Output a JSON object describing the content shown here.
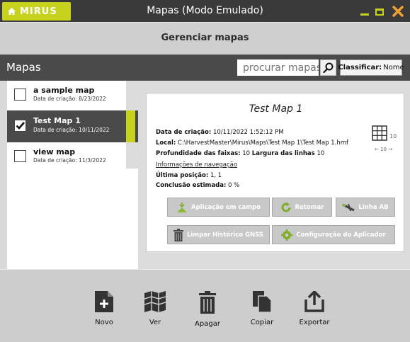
{
  "window": {
    "logo": "MIRUS",
    "title": "Mapas (Modo Emulado)"
  },
  "header": {
    "title": "Gerenciar mapas"
  },
  "toolbar": {
    "section_title": "Mapas",
    "search_placeholder": "procurar mapas",
    "sort_label": "Classificar:",
    "sort_value": "Nome"
  },
  "maps": [
    {
      "name": "a sample map",
      "date_label": "Data de criação:",
      "date": "8/23/2022",
      "selected": false
    },
    {
      "name": "Test Map 1",
      "date_label": "Data de criação:",
      "date": "10/11/2022",
      "selected": true
    },
    {
      "name": "view map",
      "date_label": "Data de criação:",
      "date": "11/3/2022",
      "selected": false
    }
  ],
  "detail": {
    "title": "Test Map 1",
    "created_label": "Data de criação:",
    "created_value": "10/11/2022 1:52:12 PM",
    "local_label": "Local:",
    "local_value": "C:\\HarvestMaster\\Mirus\\Maps\\Test Map 1\\Test Map 1.hmf",
    "depth_label": "Profundidade das faixas:",
    "depth_value": "10",
    "width_label": "Largura das linhas",
    "width_value": "10",
    "nav_link": "Informações de navegação",
    "last_pos_label": "Última posição:",
    "last_pos_value": "1, 1",
    "completion_label": "Conclusão estimada:",
    "completion_value": "0 %",
    "grid_width": "← 10 →",
    "grid_height": "10",
    "buttons": {
      "field_app": "Aplicação em campo",
      "resume": "Retomar",
      "ab_line": "Linha AB",
      "clear_gnss": "Limpar Histórico GNSS",
      "applicator_config": "Configuração do Aplicador"
    }
  },
  "bottom": {
    "new": "Novo",
    "view": "Ver",
    "delete": "Apagar",
    "copy": "Copiar",
    "export": "Exportar"
  },
  "colors": {
    "accent": "#c7d21e",
    "dark": "#3a3a3a",
    "close": "#f0a030"
  }
}
